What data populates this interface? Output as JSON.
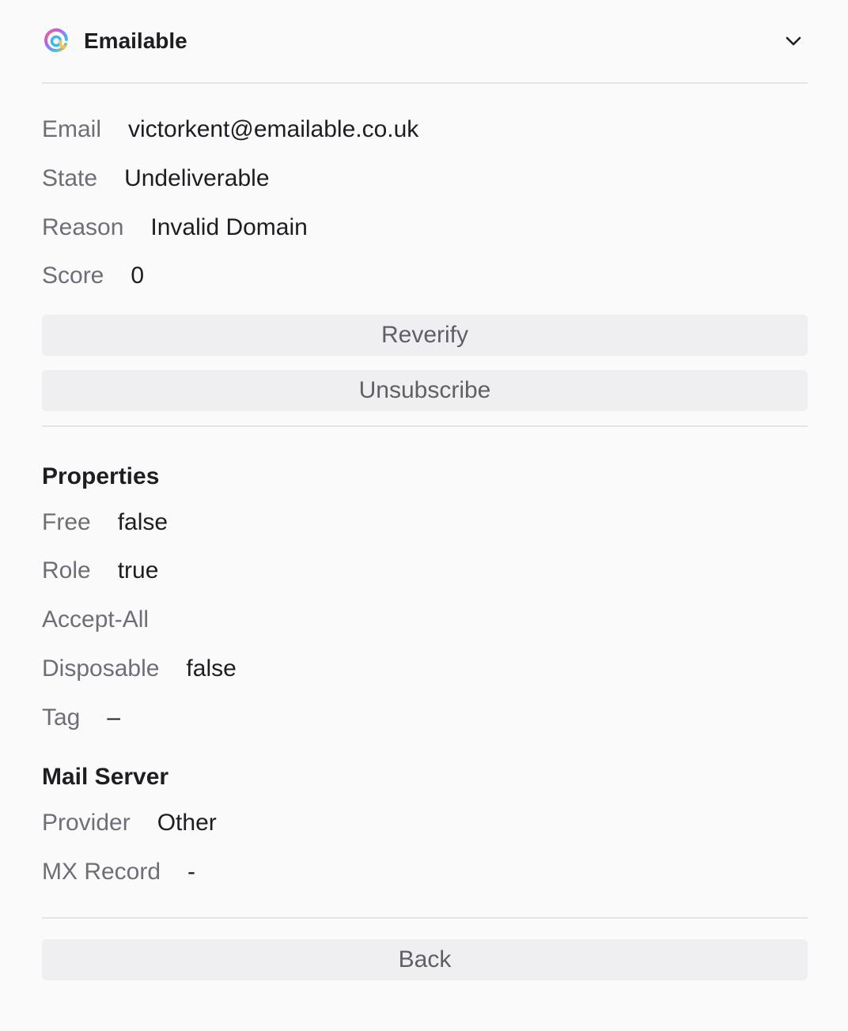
{
  "header": {
    "app_name": "Emailable",
    "logo_icon": "emailable-logo-icon",
    "toggle_icon": "chevron-down-icon"
  },
  "summary": {
    "email_label": "Email",
    "email_value": "victorkent@emailable.co.uk",
    "state_label": "State",
    "state_value": "Undeliverable",
    "reason_label": "Reason",
    "reason_value": "Invalid Domain",
    "score_label": "Score",
    "score_value": "0"
  },
  "actions": {
    "reverify_label": "Reverify",
    "unsubscribe_label": "Unsubscribe"
  },
  "properties": {
    "title": "Properties",
    "free_label": "Free",
    "free_value": "false",
    "role_label": "Role",
    "role_value": "true",
    "accept_all_label": "Accept-All",
    "accept_all_value": "",
    "disposable_label": "Disposable",
    "disposable_value": "false",
    "tag_label": "Tag",
    "tag_value": "–"
  },
  "mail_server": {
    "title": "Mail Server",
    "provider_label": "Provider",
    "provider_value": "Other",
    "mx_label": "MX Record",
    "mx_value": "-"
  },
  "footer": {
    "back_label": "Back"
  },
  "colors": {
    "background": "#fbfafb",
    "button_bg": "#efeef1",
    "label_text": "#6e6e76",
    "value_text": "#1d1d22"
  }
}
